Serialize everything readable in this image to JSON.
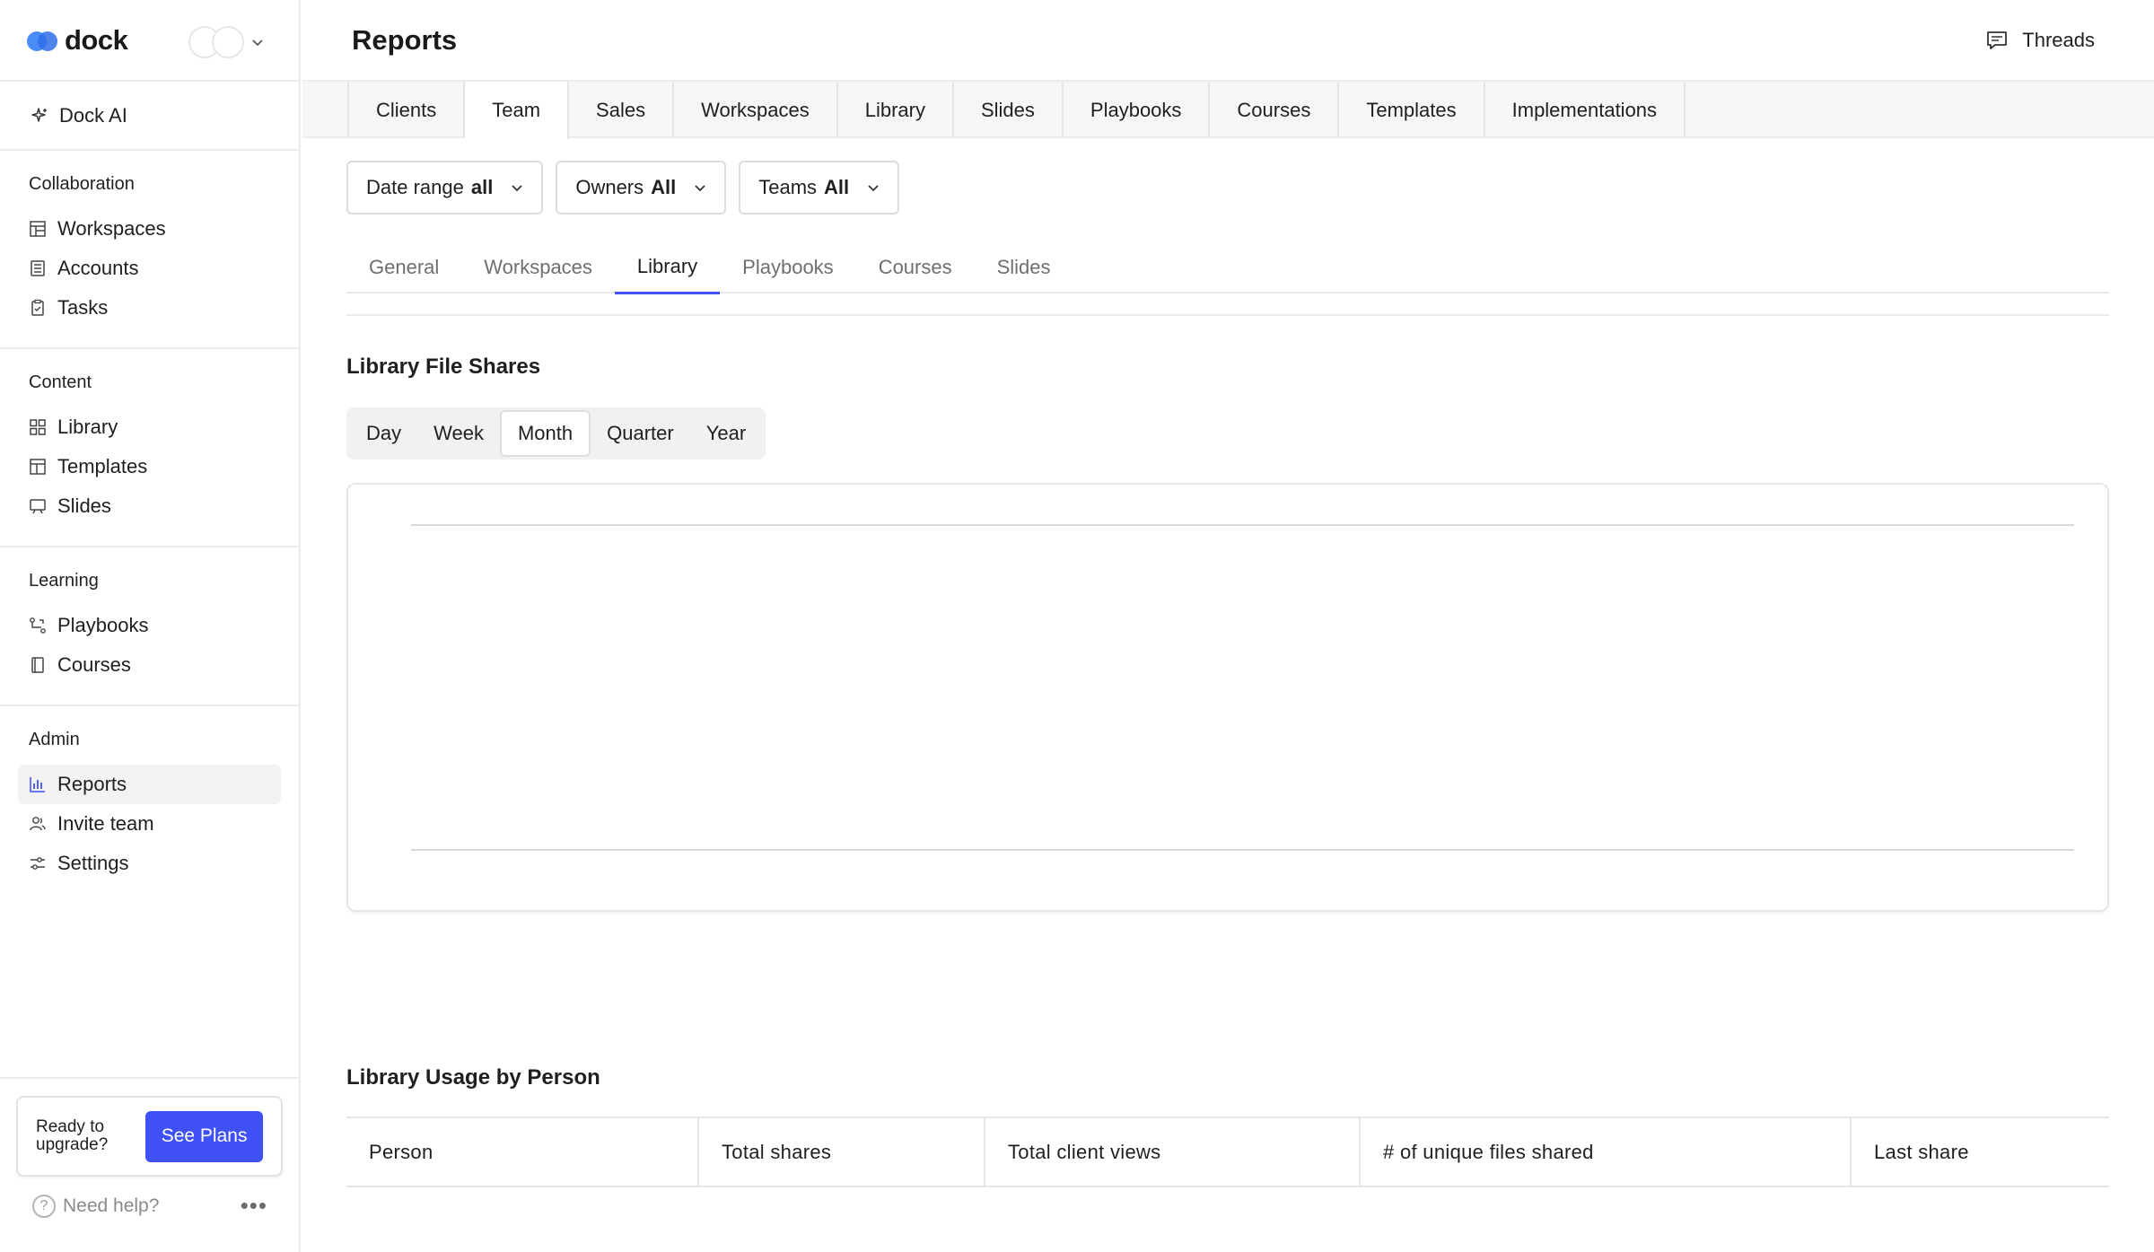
{
  "app": {
    "brand": "dock",
    "brand_color": "#3f51f5"
  },
  "sidebar": {
    "ai_label": "Dock AI",
    "sections": [
      {
        "title": "Collaboration",
        "items": [
          {
            "label": "Workspaces",
            "icon": "workspaces-icon"
          },
          {
            "label": "Accounts",
            "icon": "accounts-icon"
          },
          {
            "label": "Tasks",
            "icon": "tasks-icon"
          }
        ]
      },
      {
        "title": "Content",
        "items": [
          {
            "label": "Library",
            "icon": "library-icon"
          },
          {
            "label": "Templates",
            "icon": "templates-icon"
          },
          {
            "label": "Slides",
            "icon": "slides-icon"
          }
        ]
      },
      {
        "title": "Learning",
        "items": [
          {
            "label": "Playbooks",
            "icon": "playbooks-icon"
          },
          {
            "label": "Courses",
            "icon": "courses-icon"
          }
        ]
      },
      {
        "title": "Admin",
        "items": [
          {
            "label": "Reports",
            "icon": "reports-icon",
            "active": true
          },
          {
            "label": "Invite team",
            "icon": "invite-team-icon"
          },
          {
            "label": "Settings",
            "icon": "settings-icon"
          }
        ]
      }
    ],
    "upgrade": {
      "text": "Ready to upgrade?",
      "button": "See Plans"
    },
    "help": "Need help?"
  },
  "header": {
    "title": "Reports",
    "threads": "Threads"
  },
  "top_tabs": [
    "Clients",
    "Team",
    "Sales",
    "Workspaces",
    "Library",
    "Slides",
    "Playbooks",
    "Courses",
    "Templates",
    "Implementations"
  ],
  "top_tab_active": "Team",
  "filters": [
    {
      "label": "Date range",
      "value": "all"
    },
    {
      "label": "Owners",
      "value": "All"
    },
    {
      "label": "Teams",
      "value": "All"
    }
  ],
  "sub_tabs": [
    "General",
    "Workspaces",
    "Library",
    "Playbooks",
    "Courses",
    "Slides"
  ],
  "sub_tab_active": "Library",
  "file_shares": {
    "title": "Library File Shares",
    "periods": [
      "Day",
      "Week",
      "Month",
      "Quarter",
      "Year"
    ],
    "period_active": "Month"
  },
  "chart_data": {
    "type": "line",
    "title": "",
    "series": [],
    "x": [],
    "xlabel": "",
    "ylabel": "",
    "grid": true
  },
  "usage": {
    "title": "Library Usage by Person",
    "columns": [
      "Person",
      "Total shares",
      "Total client views",
      "# of unique files shared",
      "Last share"
    ]
  }
}
